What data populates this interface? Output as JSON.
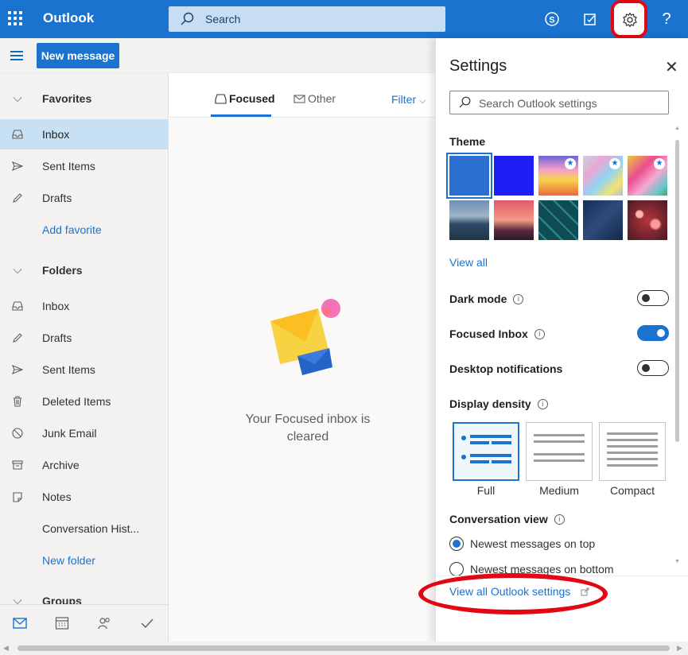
{
  "topbar": {
    "app_name": "Outlook",
    "search_placeholder": "Search",
    "help_label": "?"
  },
  "commandbar": {
    "new_message": "New message"
  },
  "nav": {
    "favorites_header": "Favorites",
    "favorites": [
      {
        "label": "Inbox",
        "icon": "inbox-icon",
        "selected": true
      },
      {
        "label": "Sent Items",
        "icon": "send-icon"
      },
      {
        "label": "Drafts",
        "icon": "pencil-icon"
      }
    ],
    "add_favorite": "Add favorite",
    "folders_header": "Folders",
    "folders": [
      {
        "label": "Inbox",
        "icon": "inbox-icon"
      },
      {
        "label": "Drafts",
        "icon": "pencil-icon"
      },
      {
        "label": "Sent Items",
        "icon": "send-icon"
      },
      {
        "label": "Deleted Items",
        "icon": "trash-icon"
      },
      {
        "label": "Junk Email",
        "icon": "block-icon"
      },
      {
        "label": "Archive",
        "icon": "archive-icon"
      },
      {
        "label": "Notes",
        "icon": "note-icon"
      },
      {
        "label": "Conversation Hist...",
        "icon": ""
      }
    ],
    "new_folder": "New folder",
    "groups_header": "Groups"
  },
  "messagelist": {
    "tab_focused": "Focused",
    "tab_other": "Other",
    "filter": "Filter",
    "empty_line1": "Your Focused inbox is",
    "empty_line2": "cleared"
  },
  "settings": {
    "title": "Settings",
    "search_placeholder": "Search Outlook settings",
    "theme_label": "Theme",
    "view_all": "View all",
    "dark_mode": {
      "label": "Dark mode",
      "on": false
    },
    "focused_inbox": {
      "label": "Focused Inbox",
      "on": true
    },
    "desktop_notifications": {
      "label": "Desktop notifications",
      "on": false
    },
    "display_density_label": "Display density",
    "density_options": [
      "Full",
      "Medium",
      "Compact"
    ],
    "density_selected": "Full",
    "conversation_view_label": "Conversation view",
    "conversation_options": [
      "Newest messages on top",
      "Newest messages on bottom"
    ],
    "conversation_selected": "Newest messages on top",
    "view_all_settings": "View all Outlook settings"
  },
  "colors": {
    "brand": "#1a73cf",
    "annotation": "#e30613"
  }
}
